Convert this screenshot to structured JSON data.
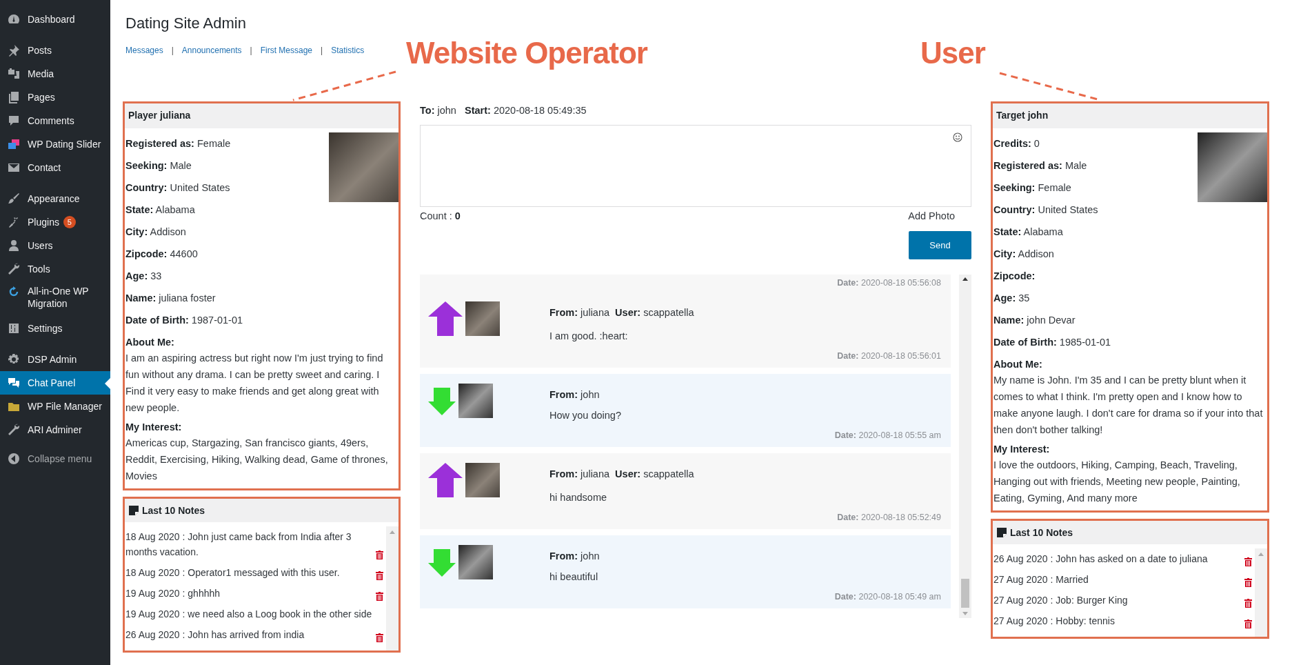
{
  "sidebar": {
    "groups": [
      {
        "items": [
          {
            "label": "Dashboard",
            "selected": false
          }
        ]
      },
      {
        "items": [
          {
            "label": "Posts",
            "selected": false
          },
          {
            "label": "Media",
            "selected": false
          },
          {
            "label": "Pages",
            "selected": false
          },
          {
            "label": "Comments",
            "selected": false
          },
          {
            "label": "WP Dating Slider",
            "selected": false
          },
          {
            "label": "Contact",
            "selected": false
          }
        ]
      },
      {
        "items": [
          {
            "label": "Appearance",
            "selected": false
          },
          {
            "label": "Plugins",
            "badge": "5",
            "selected": false
          },
          {
            "label": "Users",
            "selected": false
          },
          {
            "label": "Tools",
            "selected": false
          },
          {
            "label": "All-in-One WP Migration",
            "selected": false
          },
          {
            "label": "Settings",
            "selected": false
          }
        ]
      },
      {
        "items": [
          {
            "label": "DSP Admin",
            "selected": false
          },
          {
            "label": "Chat Panel",
            "selected": true
          },
          {
            "label": "WP File Manager",
            "selected": false
          },
          {
            "label": "ARI Adminer",
            "selected": false
          }
        ]
      }
    ],
    "collapse": "Collapse menu"
  },
  "header": {
    "title": "Dating Site Admin",
    "links": [
      {
        "label": "Messages"
      },
      {
        "label": "Announcements",
        "separator": "|"
      },
      {
        "label": "First Message",
        "separator": "|"
      },
      {
        "label": "Statistics",
        "separator": "|"
      }
    ]
  },
  "annotations": [
    {
      "text": "Website Operator"
    },
    {
      "text": "User"
    }
  ],
  "player": {
    "title": "Player juliana",
    "fields": [
      {
        "kind": "inline",
        "label": "Registered as:",
        "value": "Female"
      },
      {
        "kind": "inline",
        "label": "Seeking:",
        "value": "Male"
      },
      {
        "kind": "inline",
        "label": "Country:",
        "value": "United States"
      },
      {
        "kind": "inline",
        "label": "State:",
        "value": "Alabama"
      },
      {
        "kind": "inline",
        "label": "City:",
        "value": "Addison"
      },
      {
        "kind": "inline",
        "label": "Zipcode:",
        "value": "44600"
      },
      {
        "kind": "inline",
        "label": "Age:",
        "value": "33"
      },
      {
        "kind": "inline",
        "label": "Name:",
        "value": "juliana foster"
      },
      {
        "kind": "inline",
        "label": "Date of Birth:",
        "value": "1987-01-01"
      },
      {
        "kind": "block",
        "label": "About Me:",
        "value": "I am an aspiring actress but right now I'm just trying to find fun without any drama. I can be pretty sweet and caring. I Find it very easy to make friends and get along great with new people."
      },
      {
        "kind": "block",
        "label": "My Interest:",
        "value": "Americas cup, Stargazing, San francisco giants, 49ers, Reddit, Exercising, Hiking, Walking dead, Game of thrones, Movies"
      }
    ]
  },
  "player_notes": {
    "title": "Last 10 Notes",
    "notes": [
      {
        "text": "18 Aug 2020 : John just came back from India after 3 months vacation.",
        "deletable": true
      },
      {
        "text": "18 Aug 2020 : Operator1 messaged with this user.",
        "deletable": true
      },
      {
        "text": "19 Aug 2020 : ghhhhh",
        "deletable": true
      },
      {
        "text": "19 Aug 2020 : we need also a Loog book in the other side",
        "deletable": false
      },
      {
        "text": "26 Aug 2020 : John has arrived from india",
        "deletable": true
      }
    ]
  },
  "chat": {
    "to_label": "To:",
    "to": "john",
    "start_label": "Start:",
    "start": "2020-08-18 05:49:35",
    "count_label": "Count :",
    "count": "0",
    "add_photo": "Add Photo",
    "send": "Send",
    "messages": [
      {
        "kind": "partial",
        "date_label": "Date:",
        "date": "2020-08-18 05:56:08"
      },
      {
        "kind": "sent",
        "from_label": "From:",
        "from": "juliana",
        "user_label": "User:",
        "user": "scappatella",
        "text": "I am good. :heart:",
        "date_label": "Date:",
        "date": "2020-08-18 05:56:01"
      },
      {
        "kind": "received",
        "from_label": "From:",
        "from": "john",
        "text": "How you doing?",
        "date_label": "Date:",
        "date": "2020-08-18 05:55 am"
      },
      {
        "kind": "sent",
        "from_label": "From:",
        "from": "juliana",
        "user_label": "User:",
        "user": "scappatella",
        "text": "hi handsome",
        "date_label": "Date:",
        "date": "2020-08-18 05:52:49"
      },
      {
        "kind": "received",
        "from_label": "From:",
        "from": "john",
        "text": "hi beautiful",
        "date_label": "Date:",
        "date": "2020-08-18 05:49 am"
      }
    ]
  },
  "target": {
    "title": "Target john",
    "fields": [
      {
        "kind": "inline",
        "label": "Credits:",
        "value": "0"
      },
      {
        "kind": "inline",
        "label": "Registered as:",
        "value": "Male"
      },
      {
        "kind": "inline",
        "label": "Seeking:",
        "value": "Female"
      },
      {
        "kind": "inline",
        "label": "Country:",
        "value": "United States"
      },
      {
        "kind": "inline",
        "label": "State:",
        "value": "Alabama"
      },
      {
        "kind": "inline",
        "label": "City:",
        "value": "Addison"
      },
      {
        "kind": "inline",
        "label": "Zipcode:"
      },
      {
        "kind": "inline",
        "label": "Age:",
        "value": "35"
      },
      {
        "kind": "inline",
        "label": "Name:",
        "value": "john Devar"
      },
      {
        "kind": "inline",
        "label": "Date of Birth:",
        "value": "1985-01-01"
      },
      {
        "kind": "block",
        "label": "About Me:",
        "value": "My name is John. I'm 35 and I can be pretty blunt when it comes to what I think. I'm pretty open and I know how to make anyone laugh. I don't care for drama so if your into that then don't bother talking!"
      },
      {
        "kind": "block",
        "label": "My Interest:",
        "value": "I love the outdoors, Hiking, Camping, Beach, Traveling, Hanging out with friends, Meeting new people, Painting, Eating, Gyming, And many more"
      }
    ]
  },
  "target_notes": {
    "title": "Last 10 Notes",
    "notes": [
      {
        "text": "26 Aug 2020 : John has asked on a date to juliana",
        "deletable": true
      },
      {
        "text": "27 Aug 2020 : Married",
        "deletable": true
      },
      {
        "text": "27 Aug 2020 : Job: Burger King",
        "deletable": true
      },
      {
        "text": "27 Aug 2020 : Hobby: tennis",
        "deletable": true
      }
    ]
  }
}
